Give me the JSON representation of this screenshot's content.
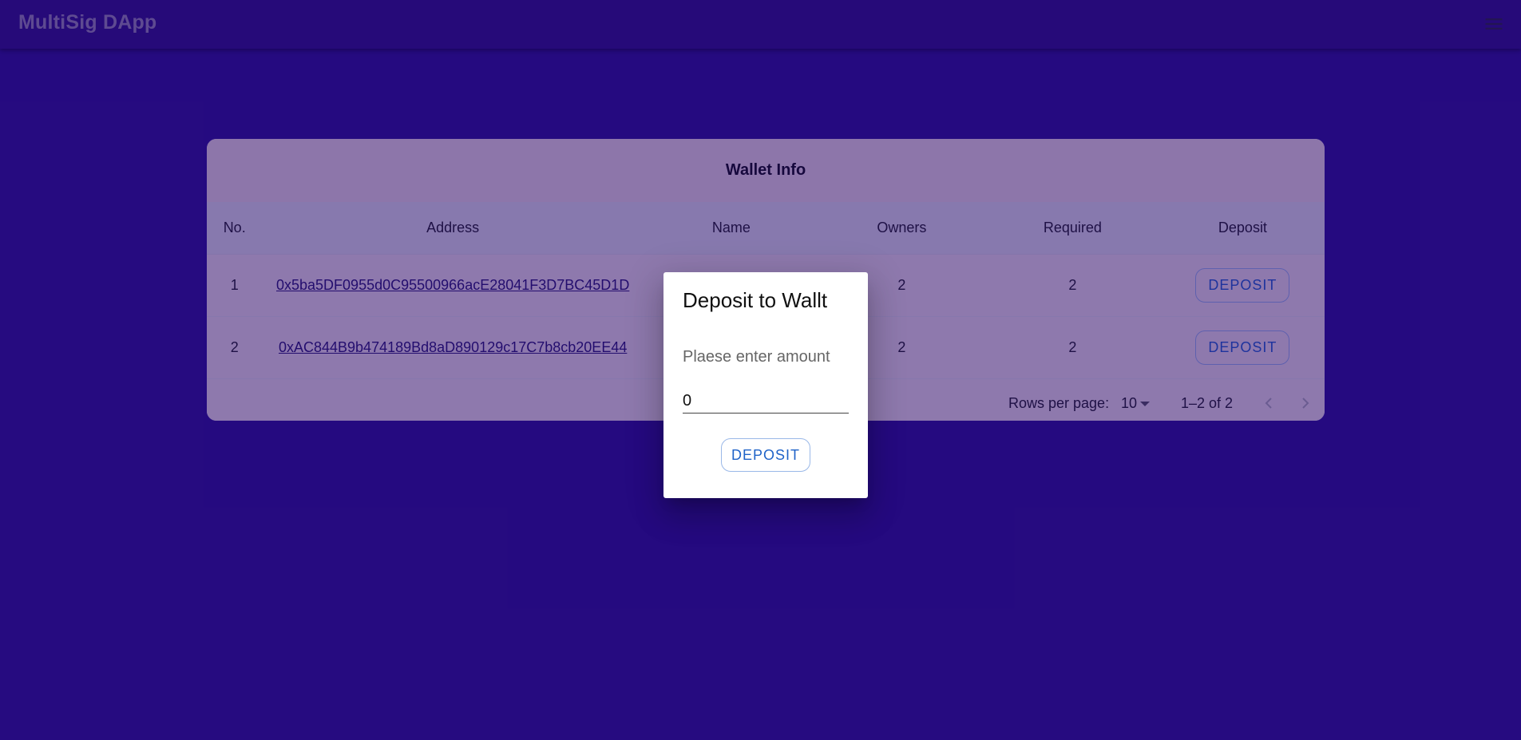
{
  "app": {
    "title": "MultiSig DApp",
    "menu_icon": "hamburger-menu-icon"
  },
  "colors": {
    "background": "#2d1590",
    "appbar": "#2e1582",
    "accent": "#1f63c8"
  },
  "wallet_table": {
    "title": "Wallet Info",
    "columns": [
      "No.",
      "Address",
      "Name",
      "Owners",
      "Required",
      "Deposit"
    ],
    "rows": [
      {
        "no": "1",
        "address": "0x5ba5DF0955d0C95500966acE28041F3D7BC45D1D",
        "name": "",
        "owners": "2",
        "required": "2",
        "action": "DEPOSIT"
      },
      {
        "no": "2",
        "address": "0xAC844B9b474189Bd8aD890129c17C7b8cb20EE44",
        "name": "",
        "owners": "2",
        "required": "2",
        "action": "DEPOSIT"
      }
    ],
    "pagination": {
      "rows_per_page_label": "Rows per page:",
      "rows_per_page_value": "10",
      "range": "1–2 of 2",
      "prev_icon": "chevron-left-icon",
      "next_icon": "chevron-right-icon"
    }
  },
  "dialog": {
    "title": "Deposit to Wallt",
    "label": "Plaese enter amount",
    "amount_value": "0",
    "button": "DEPOSIT"
  }
}
